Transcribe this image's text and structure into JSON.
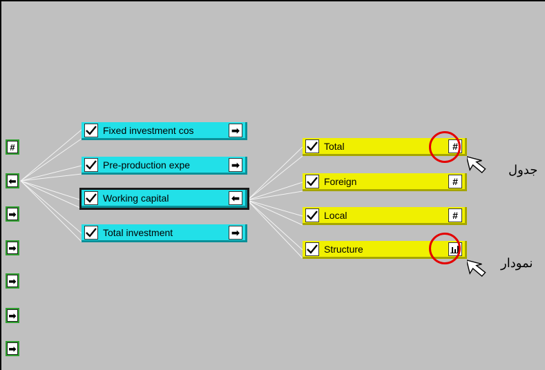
{
  "tree": {
    "investment_nodes": [
      {
        "label": "Fixed investment cos",
        "button": "arrow-right"
      },
      {
        "label": "Pre-production expe",
        "button": "arrow-right"
      },
      {
        "label": "Working capital",
        "button": "arrow-left"
      },
      {
        "label": "Total investment",
        "button": "arrow-right"
      }
    ],
    "detail_nodes": [
      {
        "label": "Total",
        "button": "table"
      },
      {
        "label": "Foreign",
        "button": "table"
      },
      {
        "label": "Local",
        "button": "table"
      },
      {
        "label": "Structure",
        "button": "bar-chart"
      }
    ],
    "side_buttons": [
      "table",
      "arrow-left",
      "arrow-right",
      "arrow-right",
      "arrow-right",
      "arrow-right",
      "arrow-right"
    ]
  },
  "annotations": {
    "table_label": "جدول",
    "chart_label": "نمودار",
    "highlight_color": "#e30000"
  },
  "colors": {
    "background": "#c0c0c0",
    "cyan_node": "#22e0e8",
    "yellow_node": "#f0f000",
    "side_button": "#2e9f2e"
  }
}
